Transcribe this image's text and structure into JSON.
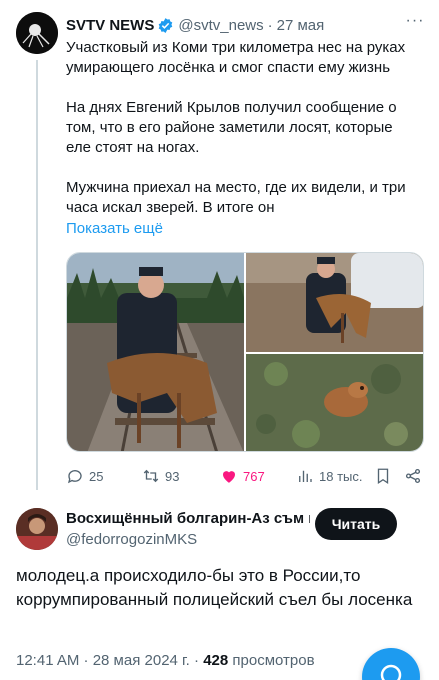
{
  "tweet": {
    "author_name": "SVTV NEWS",
    "author_handle": "@svtv_news",
    "dot": "·",
    "date": "27 мая",
    "more_label": "···",
    "paragraphs": [
      "Участковый из Коми три километра нес на руках умирающего лосёнка и смог спасти ему жизнь",
      "На днях Евгений Крылов получил сообщение о том, что в его районе заметили лосят, которые еле стоят на ногах.",
      "Мужчина приехал на место, где их видели, и три часа искал зверей. В итоге он"
    ],
    "show_more": "Показать ещё",
    "verified_color": "#1d9bf0",
    "media_images": [
      "policeman-carrying-moose-calf-on-railway",
      "policeman-with-moose-calf-by-car",
      "moose-calf-lying-on-ground"
    ],
    "actions": {
      "replies": "25",
      "reposts": "93",
      "likes": "767",
      "views": "18 тыс."
    }
  },
  "reply": {
    "author_name": "Восхищённый болгарин-Аз съм в",
    "author_handle": "@fedorrogozinMKS",
    "follow_label": "Читать",
    "text": "молодец.а происходило-бы это в России,то коррумпированный полицейский съел бы лосенка",
    "time": "12:41 AM · 28 мая 2024 г. ·",
    "views_count": "428",
    "views_label": "просмотров"
  },
  "colors": {
    "accent": "#1d9bf0",
    "like": "#f91880",
    "text": "#0f1419",
    "secondary": "#536471"
  },
  "icons": [
    "reply-icon",
    "repost-icon",
    "heart-icon",
    "views-icon",
    "bookmark-icon",
    "share-icon",
    "verified-icon",
    "compose-icon"
  ]
}
